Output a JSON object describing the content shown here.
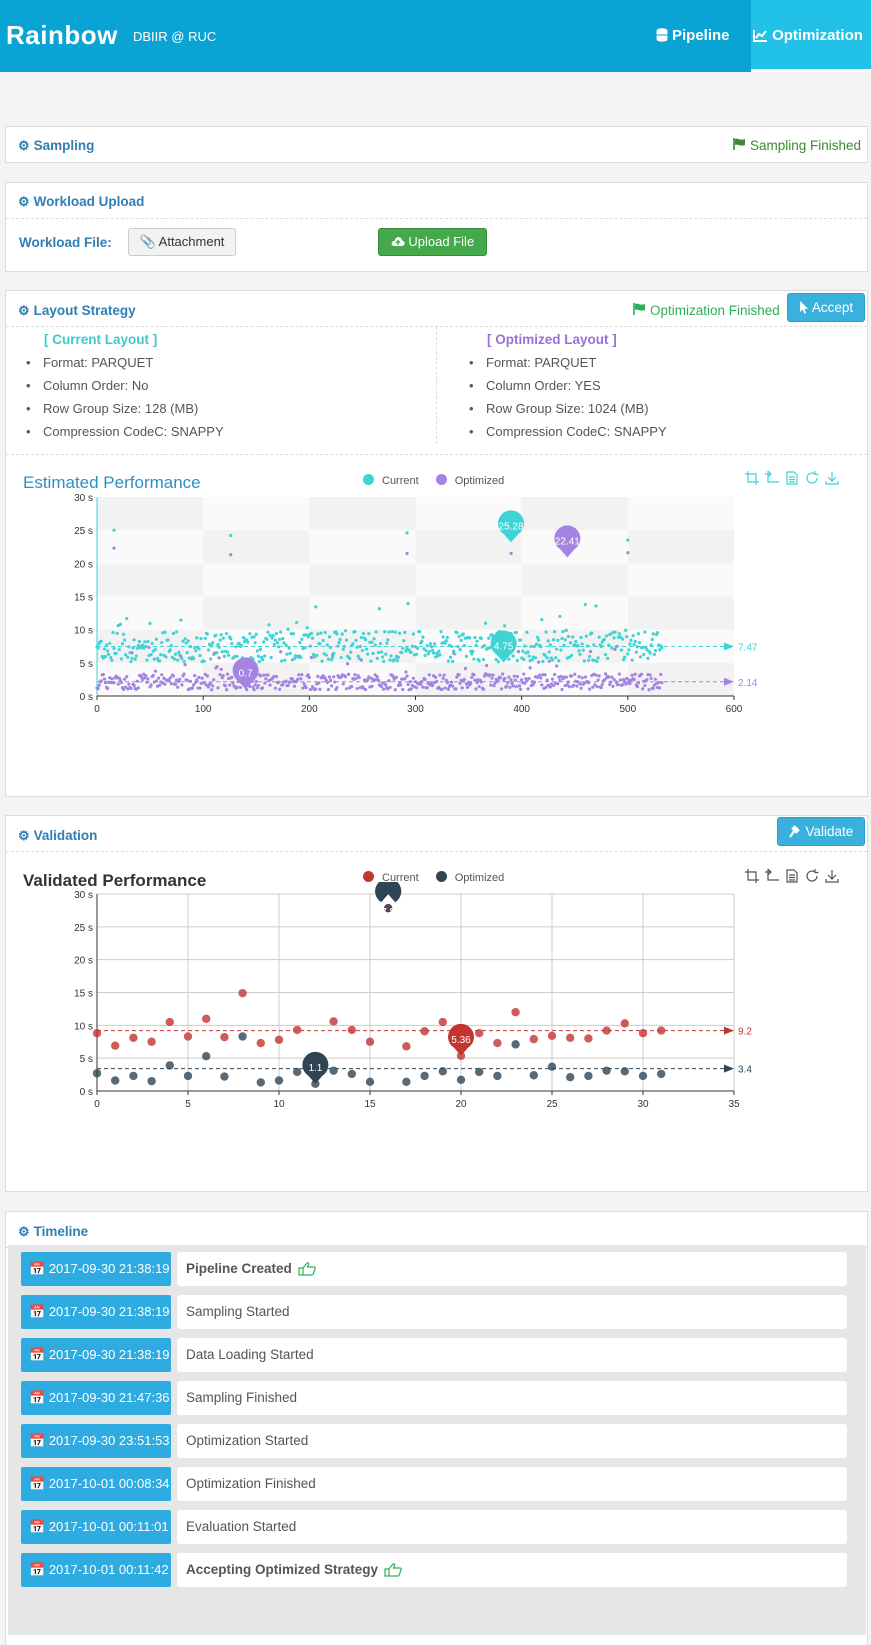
{
  "header": {
    "brand": "Rainbow",
    "subtitle": "DBIIR @ RUC",
    "nav": [
      {
        "label": "Pipeline",
        "icon": "database-icon"
      },
      {
        "label": "Optimization",
        "icon": "line-chart-icon",
        "active": true
      }
    ]
  },
  "sampling": {
    "title": "Sampling",
    "status": "Sampling Finished"
  },
  "workload": {
    "title": "Workload Upload",
    "file_label": "Workload File:",
    "attach_label": "Attachment",
    "upload_label": "Upload File"
  },
  "layout": {
    "title": "Layout Strategy",
    "status": "Optimization Finished",
    "accept_label": "Accept",
    "current": {
      "heading": "[ Current Layout ]",
      "items": [
        "Format: PARQUET",
        "Column Order: No",
        "Row Group Size: 128 (MB)",
        "Compression CodeC: SNAPPY"
      ]
    },
    "optimized": {
      "heading": "[ Optimized Layout ]",
      "items": [
        "Format: PARQUET",
        "Column Order: YES",
        "Row Group Size: 1024 (MB)",
        "Compression CodeC: SNAPPY"
      ]
    }
  },
  "estimated_chart": {
    "title": "Estimated Performance",
    "legend": [
      "Current",
      "Optimized"
    ]
  },
  "validation": {
    "title": "Validation",
    "validate_label": "Validate",
    "chart_title": "Validated Performance",
    "legend": [
      "Current",
      "Optimized"
    ]
  },
  "timeline": {
    "title": "Timeline",
    "events": [
      {
        "date": "2017-09-30 21:38:19",
        "text": "Pipeline Created",
        "bold": true
      },
      {
        "date": "2017-09-30 21:38:19",
        "text": "Sampling Started",
        "bold": false
      },
      {
        "date": "2017-09-30 21:38:19",
        "text": "Data Loading Started",
        "bold": false
      },
      {
        "date": "2017-09-30 21:47:36",
        "text": "Sampling Finished",
        "bold": false
      },
      {
        "date": "2017-09-30 23:51:53",
        "text": "Optimization Started",
        "bold": false
      },
      {
        "date": "2017-10-01 00:08:34",
        "text": "Optimization Finished",
        "bold": false
      },
      {
        "date": "2017-10-01 00:11:01",
        "text": "Evaluation Started",
        "bold": false
      },
      {
        "date": "2017-10-01 00:11:42",
        "text": "Accepting Optimized Strategy",
        "bold": true
      }
    ]
  },
  "colors": {
    "current_est": "#3fd3d4",
    "optimized_est": "#a583e3",
    "current_val": "#c23531",
    "optimized_val": "#2f4554",
    "header": "#0aa4d4"
  },
  "chart_data": [
    {
      "type": "scatter",
      "title": "Estimated Performance",
      "series": [
        {
          "name": "Current",
          "mean": 7.47,
          "max": 25.28,
          "min": 4.75
        },
        {
          "name": "Optimized",
          "mean": 2.14,
          "max": 22.41,
          "min": 0.7
        }
      ],
      "xlim": [
        0,
        600
      ],
      "xticks": [
        0,
        100,
        200,
        300,
        400,
        500,
        600
      ],
      "ylim": [
        0,
        30
      ],
      "yticks": [
        "0 s",
        "5 s",
        "10 s",
        "15 s",
        "20 s",
        "25 s",
        "30 s"
      ],
      "n_points": 533
    },
    {
      "type": "scatter",
      "title": "Validated Performance",
      "x": [
        0,
        1,
        2,
        3,
        4,
        5,
        6,
        7,
        8,
        9,
        10,
        11,
        12,
        13,
        14,
        15,
        16,
        17,
        18,
        19,
        20,
        21,
        22,
        23,
        24,
        25,
        26,
        27,
        28,
        29,
        30,
        31
      ],
      "series": [
        {
          "name": "Current",
          "values": [
            8.8,
            6.9,
            8.1,
            7.5,
            10.5,
            8.3,
            11.0,
            8.2,
            14.9,
            7.3,
            7.8,
            9.3,
            4.4,
            10.6,
            9.3,
            7.5,
            27.84,
            6.8,
            9.1,
            10.5,
            5.36,
            8.8,
            7.3,
            12.0,
            7.9,
            8.4,
            8.1,
            8.0,
            9.2,
            10.3,
            8.8,
            9.2
          ],
          "mean": 9.2,
          "max": 27.84,
          "min": 5.36
        },
        {
          "name": "Optimized",
          "values": [
            2.7,
            1.6,
            2.3,
            1.5,
            3.9,
            2.3,
            5.3,
            2.2,
            8.3,
            1.3,
            1.6,
            2.9,
            1.1,
            3.1,
            2.6,
            1.4,
            27.84,
            1.4,
            2.3,
            3.0,
            1.7,
            2.9,
            2.3,
            7.1,
            2.4,
            3.7,
            2.1,
            2.3,
            3.1,
            3.0,
            2.3,
            2.6
          ],
          "mean": 3.4,
          "max": 27.84,
          "min": 1.1
        }
      ],
      "xlim": [
        0,
        35
      ],
      "xticks": [
        0,
        5,
        10,
        15,
        20,
        25,
        30,
        35
      ],
      "ylim": [
        0,
        30
      ],
      "yticks": [
        "0 s",
        "5 s",
        "10 s",
        "15 s",
        "20 s",
        "25 s",
        "30 s"
      ]
    }
  ]
}
